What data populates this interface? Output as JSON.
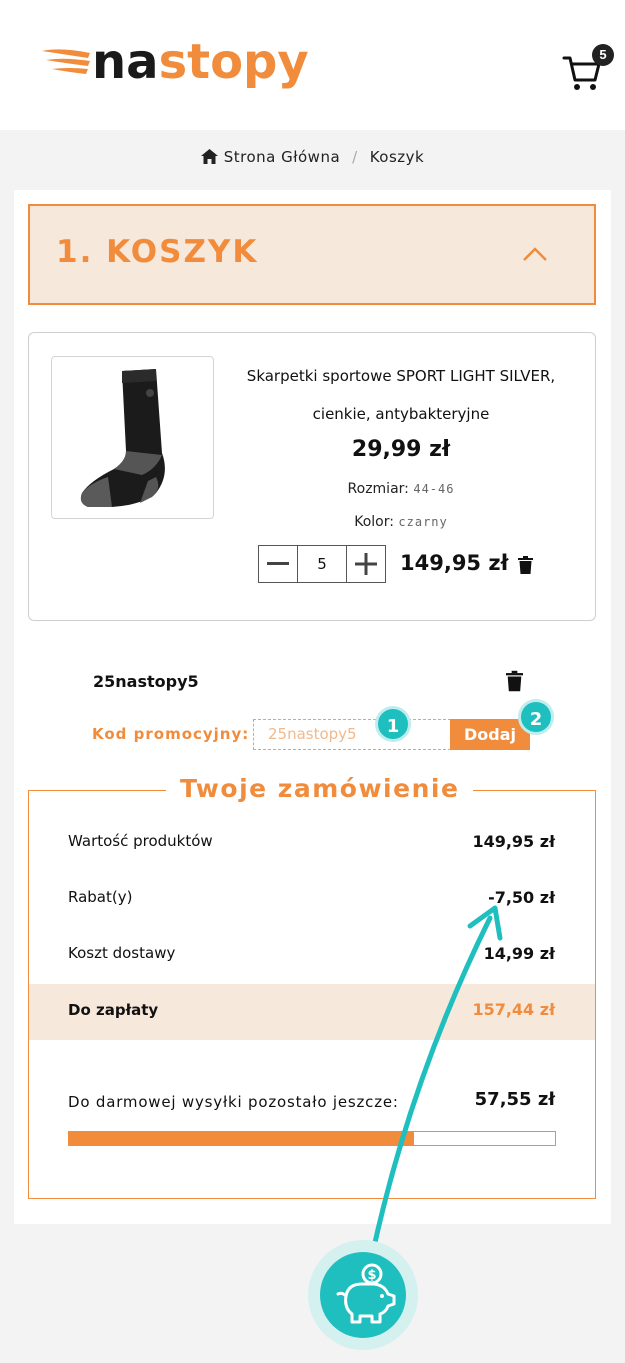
{
  "header": {
    "logo_part1": "na",
    "logo_part2": "stopy",
    "cart_count": "5"
  },
  "breadcrumb": {
    "home": "Strona Główna",
    "separator": "/",
    "current": "Koszyk"
  },
  "cart_section": {
    "title": "1. KOSZYK"
  },
  "product": {
    "name": "Skarpetki sportowe SPORT LIGHT SILVER, cienkie, antybakteryjne",
    "price": "29,99 zł",
    "size_label": "Rozmiar:",
    "size_value": "44-46",
    "color_label": "Kolor:",
    "color_value": "czarny",
    "quantity": "5",
    "line_total": "149,95 zł"
  },
  "promo": {
    "applied_code": "25nastopy5",
    "label": "Kod promocyjny:",
    "input_placeholder": "25nastopy5",
    "button_label": "Dodaj",
    "step1": "1",
    "step2": "2"
  },
  "order": {
    "title": "Twoje zamówienie",
    "rows": [
      {
        "label": "Wartość produktów",
        "value": "149,95 zł"
      },
      {
        "label": "Rabat(y)",
        "value": "-7,50 zł"
      },
      {
        "label": "Koszt dostawy",
        "value": "14,99 zł"
      }
    ],
    "total_label": "Do zapłaty",
    "total_value": "157,44 zł",
    "free_shipping_label": "Do darmowej wysyłki pozostało jeszcze:",
    "free_shipping_value": "57,55 zł",
    "free_shipping_progress": 0.71
  },
  "colors": {
    "accent": "#f08c3c",
    "accent_light": "#f7e8dc",
    "teal": "#1ebfbe"
  },
  "icons": [
    "cart-icon",
    "home-icon",
    "chevron-up-icon",
    "minus-icon",
    "plus-icon",
    "trash-icon",
    "piggy-bank-icon"
  ]
}
